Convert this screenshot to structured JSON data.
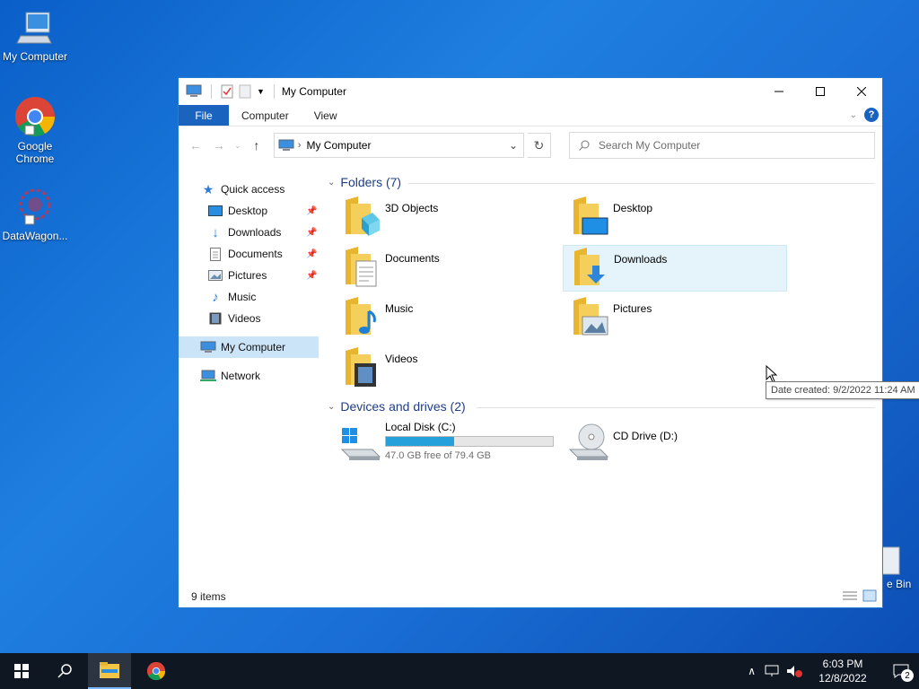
{
  "desktop": {
    "icons": [
      {
        "label": "My Computer"
      },
      {
        "label": "Google Chrome"
      },
      {
        "label": "DataWagon..."
      }
    ],
    "recycle_label": "e Bin"
  },
  "window": {
    "title": "My Computer",
    "ribbon_tabs": [
      "File",
      "Computer",
      "View"
    ],
    "address": "My Computer",
    "search_placeholder": "Search My Computer",
    "sidebar": {
      "quick_access": "Quick access",
      "items": [
        {
          "label": "Desktop",
          "pinned": true
        },
        {
          "label": "Downloads",
          "pinned": true
        },
        {
          "label": "Documents",
          "pinned": true
        },
        {
          "label": "Pictures",
          "pinned": true
        },
        {
          "label": "Music",
          "pinned": false
        },
        {
          "label": "Videos",
          "pinned": false
        }
      ],
      "my_computer": "My Computer",
      "network": "Network"
    },
    "folders_header": "Folders (7)",
    "folders": [
      {
        "label": "3D Objects"
      },
      {
        "label": "Desktop"
      },
      {
        "label": "Documents"
      },
      {
        "label": "Downloads"
      },
      {
        "label": "Music"
      },
      {
        "label": "Pictures"
      },
      {
        "label": "Videos"
      }
    ],
    "devices_header": "Devices and drives (2)",
    "drives": [
      {
        "label": "Local Disk (C:)",
        "free_text": "47.0 GB free of 79.4 GB",
        "used_fraction": 0.41
      },
      {
        "label": "CD Drive (D:)"
      }
    ],
    "tooltip": "Date created: 9/2/2022 11:24 AM",
    "status": "9 items"
  },
  "taskbar": {
    "time": "6:03 PM",
    "date": "12/8/2022",
    "notifications": "2"
  },
  "colors": {
    "accent": "#1a64c0",
    "folder": "#f3c546",
    "selection": "#cce4f7"
  }
}
